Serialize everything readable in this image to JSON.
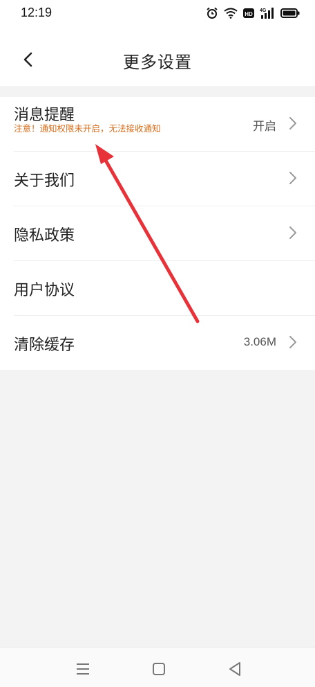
{
  "status_bar": {
    "time": "12:19",
    "icons": [
      "alarm-icon",
      "wifi-icon",
      "hd-icon",
      "signal-4g-icon",
      "battery-icon"
    ]
  },
  "header": {
    "title": "更多设置",
    "back_icon": "chevron-left-icon"
  },
  "settings": [
    {
      "label": "消息提醒",
      "warning": "注意！通知权限未开启，无法接收通知",
      "value": "开启",
      "chevron": true
    },
    {
      "label": "关于我们",
      "value": "",
      "chevron": true
    },
    {
      "label": "隐私政策",
      "value": "",
      "chevron": true
    },
    {
      "label": "用户协议",
      "value": "",
      "chevron": false
    },
    {
      "label": "清除缓存",
      "value": "3.06M",
      "chevron": true
    }
  ],
  "nav_bar": {
    "icons": [
      "menu-icon",
      "home-icon",
      "back-icon"
    ]
  },
  "colors": {
    "warning": "#d86d1b",
    "annotation_arrow": "#e8323a",
    "background": "#f3f3f3"
  }
}
